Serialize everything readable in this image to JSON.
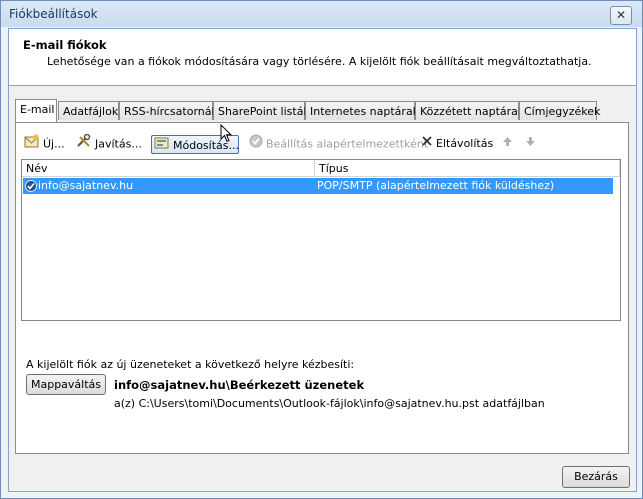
{
  "window": {
    "title": "Fiókbeállítások",
    "close_glyph": "✕"
  },
  "header": {
    "title": "E-mail fiókok",
    "subtitle": "Lehetősége van a fiókok módosítására vagy törlésére. A kijelölt fiók beállításait megváltoztathatja."
  },
  "tabs": [
    {
      "label": "E-mail",
      "active": true
    },
    {
      "label": "Adatfájlok",
      "active": false
    },
    {
      "label": "RSS-hírcsatornák",
      "active": false
    },
    {
      "label": "SharePoint listák",
      "active": false
    },
    {
      "label": "Internetes naptárak",
      "active": false
    },
    {
      "label": "Közzétett naptárak",
      "active": false
    },
    {
      "label": "Címjegyzékek",
      "active": false
    }
  ],
  "toolbar": {
    "new_label": "Új...",
    "repair_label": "Javítás...",
    "change_label": "Módosítás...",
    "default_label": "Beállítás alapértelmezettként",
    "remove_label": "Eltávolítás",
    "up_icon": "arrow-up-icon",
    "down_icon": "arrow-down-icon"
  },
  "accounts": {
    "columns": [
      "Név",
      "Típus"
    ],
    "rows": [
      {
        "name": "info@sajatnev.hu",
        "type": "POP/SMTP (alapértelmezett fiók küldéshez)",
        "selected": true
      }
    ]
  },
  "delivery": {
    "label": "A kijelölt fiók az új üzeneteket a következő helyre kézbesíti:",
    "change_folder_button": "Mappaváltás",
    "destination": "info@sajatnev.hu\\Beérkezett üzenetek",
    "path": "a(z) C:\\Users\\tomi\\Documents\\Outlook-fájlok\\info@sajatnev.hu.pst adatfájlban"
  },
  "footer": {
    "close_button": "Bezárás"
  },
  "colors": {
    "selection": "#3399ff",
    "title_bg": "#c9dbf0",
    "header_bg": "#ffffff"
  }
}
